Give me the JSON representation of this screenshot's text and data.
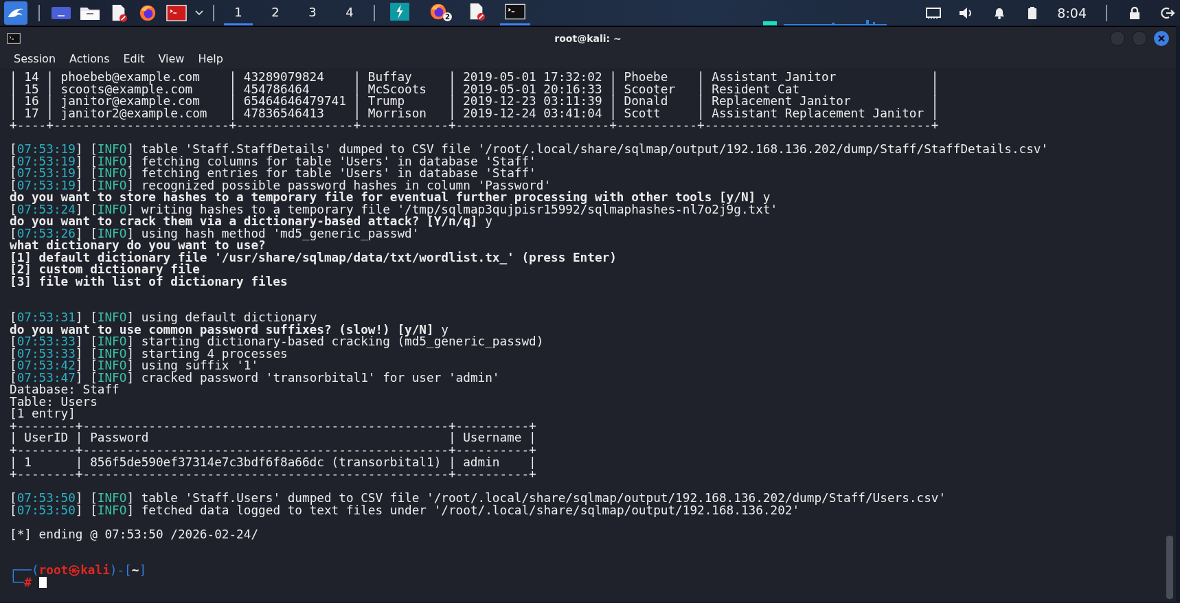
{
  "taskbar": {
    "launchers": [
      {
        "kind": "kali-menu"
      },
      {
        "kind": "desktop"
      },
      {
        "kind": "files"
      },
      {
        "kind": "editor"
      },
      {
        "kind": "browser"
      },
      {
        "kind": "terminal-red"
      },
      {
        "kind": "chevron"
      }
    ],
    "workspaces": [
      {
        "label": "1",
        "selected": true
      },
      {
        "label": "2",
        "selected": false
      },
      {
        "label": "3",
        "selected": false
      },
      {
        "label": "4",
        "selected": false
      }
    ],
    "tasks": [
      {
        "kind": "bolt-app",
        "selected": false
      },
      {
        "kind": "browser",
        "selected": false,
        "badge": "2"
      },
      {
        "kind": "editor",
        "selected": false
      },
      {
        "kind": "terminal",
        "selected": true
      }
    ],
    "clock": "8:04"
  },
  "window": {
    "title": "root@kali: ~",
    "menu": [
      "Session",
      "Actions",
      "Edit",
      "View",
      "Help"
    ]
  },
  "terminal": {
    "lines": [
      {
        "kind": "table",
        "text": "| 14 | phoebeb@example.com    | 43289079824    | Buffay     | 2019-05-01 17:32:02 | Phoebe    | Assistant Janitor             |"
      },
      {
        "kind": "table",
        "text": "| 15 | scoots@example.com     | 454786464      | McScoots   | 2019-05-01 20:16:33 | Scooter   | Resident Cat                  |"
      },
      {
        "kind": "table",
        "text": "| 16 | janitor@example.com    | 65464646479741 | Trump      | 2019-12-23 03:11:39 | Donald    | Replacement Janitor           |"
      },
      {
        "kind": "table",
        "text": "| 17 | janitor2@example.com   | 47836546413    | Morrison   | 2019-12-24 03:41:04 | Scott     | Assistant Replacement Janitor |"
      },
      {
        "kind": "border",
        "text": "+----+------------------------+----------------+------------+---------------------+-----------+-------------------------------+"
      },
      {
        "kind": "blank"
      },
      {
        "kind": "log",
        "time": "[07:53:19]",
        "level": "[INFO]",
        "message": "table 'Staff.StaffDetails' dumped to CSV file '/root/.local/share/sqlmap/output/192.168.136.202/dump/Staff/StaffDetails.csv'"
      },
      {
        "kind": "log",
        "time": "[07:53:19]",
        "level": "[INFO]",
        "message": "fetching columns for table 'Users' in database 'Staff'"
      },
      {
        "kind": "log",
        "time": "[07:53:19]",
        "level": "[INFO]",
        "message": "fetching entries for table 'Users' in database 'Staff'"
      },
      {
        "kind": "log",
        "time": "[07:53:19]",
        "level": "[INFO]",
        "message": "recognized possible password hashes in column 'Password'"
      },
      {
        "kind": "question",
        "text": "do you want to store hashes to a temporary file for eventual further processing with other tools [y/N]",
        "answer": "y"
      },
      {
        "kind": "log",
        "time": "[07:53:24]",
        "level": "[INFO]",
        "message": "writing hashes to a temporary file '/tmp/sqlmap3qujpisr15992/sqlmaphashes-nl7o2j9g.txt'"
      },
      {
        "kind": "question",
        "text": "do you want to crack them via a dictionary-based attack? [Y/n/q]",
        "answer": "y"
      },
      {
        "kind": "log",
        "time": "[07:53:26]",
        "level": "[INFO]",
        "message": "using hash method 'md5_generic_passwd'"
      },
      {
        "kind": "question",
        "text": "what dictionary do you want to use?"
      },
      {
        "kind": "question",
        "text": "[1] default dictionary file '/usr/share/sqlmap/data/txt/wordlist.tx_' (press Enter)"
      },
      {
        "kind": "question",
        "text": "[2] custom dictionary file"
      },
      {
        "kind": "question",
        "text": "[3] file with list of dictionary files"
      },
      {
        "kind": "blank"
      },
      {
        "kind": "blank"
      },
      {
        "kind": "log",
        "time": "[07:53:31]",
        "level": "[INFO]",
        "message": "using default dictionary"
      },
      {
        "kind": "question",
        "text": "do you want to use common password suffixes? (slow!) [y/N]",
        "answer": "y"
      },
      {
        "kind": "log",
        "time": "[07:53:33]",
        "level": "[INFO]",
        "message": "starting dictionary-based cracking (md5_generic_passwd)"
      },
      {
        "kind": "log",
        "time": "[07:53:33]",
        "level": "[INFO]",
        "message": "starting 4 processes"
      },
      {
        "kind": "log",
        "time": "[07:53:42]",
        "level": "[INFO]",
        "message": "using suffix '1'"
      },
      {
        "kind": "log",
        "time": "[07:53:47]",
        "level": "[INFO]",
        "message": "cracked password 'transorbital1' for user 'admin'"
      },
      {
        "kind": "output",
        "text": "Database: Staff"
      },
      {
        "kind": "output",
        "text": "Table: Users"
      },
      {
        "kind": "output",
        "text": "[1 entry]"
      },
      {
        "kind": "border",
        "text": "+--------+--------------------------------------------------+----------+"
      },
      {
        "kind": "table",
        "text": "| UserID | Password                                         | Username |"
      },
      {
        "kind": "border",
        "text": "+--------+--------------------------------------------------+----------+"
      },
      {
        "kind": "table",
        "text": "| 1      | 856f5de590ef37314e7c3bdf6f8a66dc (transorbital1) | admin    |"
      },
      {
        "kind": "border",
        "text": "+--------+--------------------------------------------------+----------+"
      },
      {
        "kind": "blank"
      },
      {
        "kind": "log",
        "time": "[07:53:50]",
        "level": "[INFO]",
        "message": "table 'Staff.Users' dumped to CSV file '/root/.local/share/sqlmap/output/192.168.136.202/dump/Staff/Users.csv'"
      },
      {
        "kind": "log",
        "time": "[07:53:50]",
        "level": "[INFO]",
        "message": "fetched data logged to text files under '/root/.local/share/sqlmap/output/192.168.136.202'"
      },
      {
        "kind": "blank"
      },
      {
        "kind": "output",
        "text": "[*] ending @ 07:53:50 /2026-02-24/"
      },
      {
        "kind": "blank"
      },
      {
        "kind": "blank"
      },
      {
        "kind": "prompt",
        "frame_start": "┌──(",
        "user": "root㉿kali",
        "frame_mid": ")-[",
        "path": "~",
        "frame_end": "]"
      },
      {
        "kind": "input",
        "frame": "└─",
        "symbol": "#",
        "cursor": true
      }
    ]
  }
}
